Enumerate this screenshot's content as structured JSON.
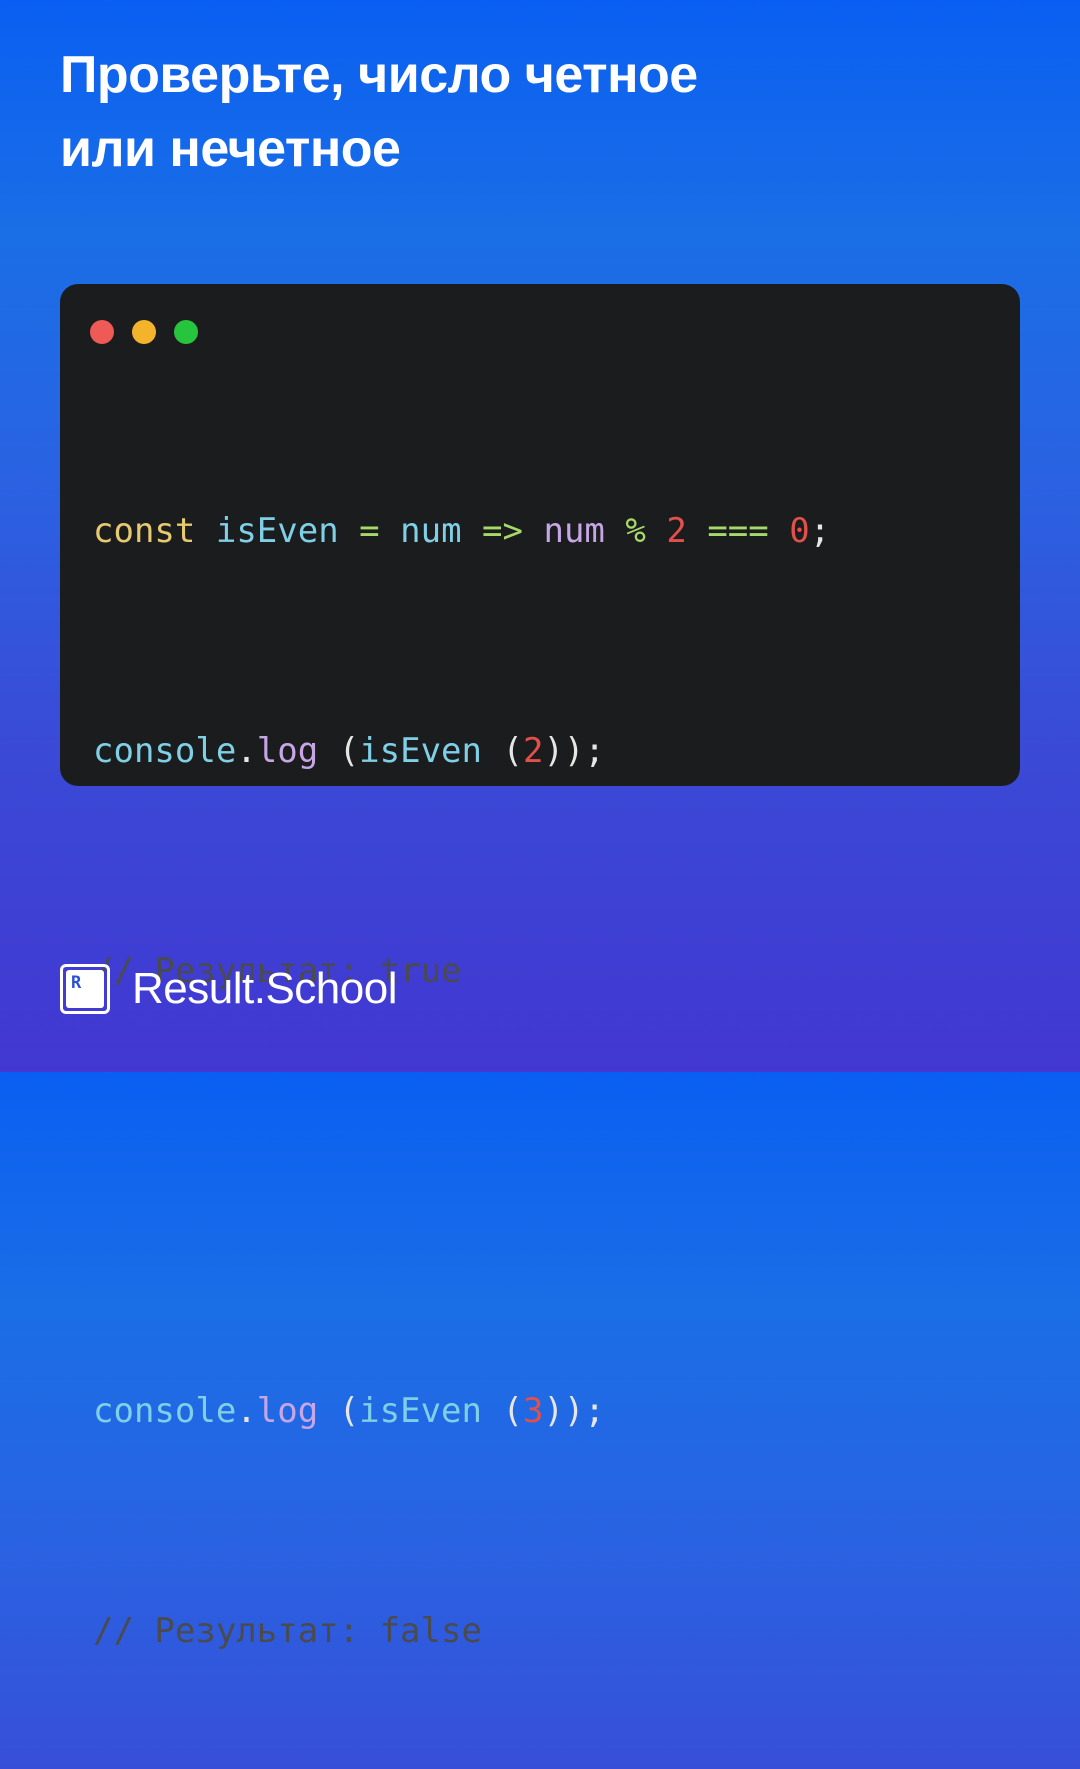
{
  "title": {
    "line1": "Проверьте, число четное",
    "line2": "или нечетное"
  },
  "window": {
    "controls": [
      {
        "name": "close",
        "color": "#ee5a55"
      },
      {
        "name": "minimize",
        "color": "#f3b42b"
      },
      {
        "name": "maximize",
        "color": "#27c53e"
      }
    ]
  },
  "code": {
    "line1": {
      "kw": "const",
      "sp1": " ",
      "id": "isEven",
      "sp2": " ",
      "eq": "=",
      "sp3": " ",
      "param": "num",
      "sp4": " ",
      "arrow": "=>",
      "sp5": " ",
      "var": "num",
      "sp6": " ",
      "mod": "%",
      "sp7": " ",
      "two": "2",
      "sp8": " ",
      "strict": "===",
      "sp9": " ",
      "zero": "0",
      "semi": ";"
    },
    "line2": {
      "obj": "console",
      "dot": ".",
      "fn": "log",
      "sp1": " ",
      "p1": "(",
      "call": "isEven",
      "sp2": " ",
      "p2": "(",
      "arg": "2",
      "close": "));"
    },
    "line3": "// Результат: true",
    "line5": {
      "obj": "console",
      "dot": ".",
      "fn": "log",
      "sp1": " ",
      "p1": "(",
      "call": "isEven",
      "sp2": " ",
      "p2": "(",
      "arg": "3",
      "close": "));"
    },
    "line6": "// Результат: false"
  },
  "brand": {
    "logo_letter": "R",
    "name": "Result.School"
  }
}
